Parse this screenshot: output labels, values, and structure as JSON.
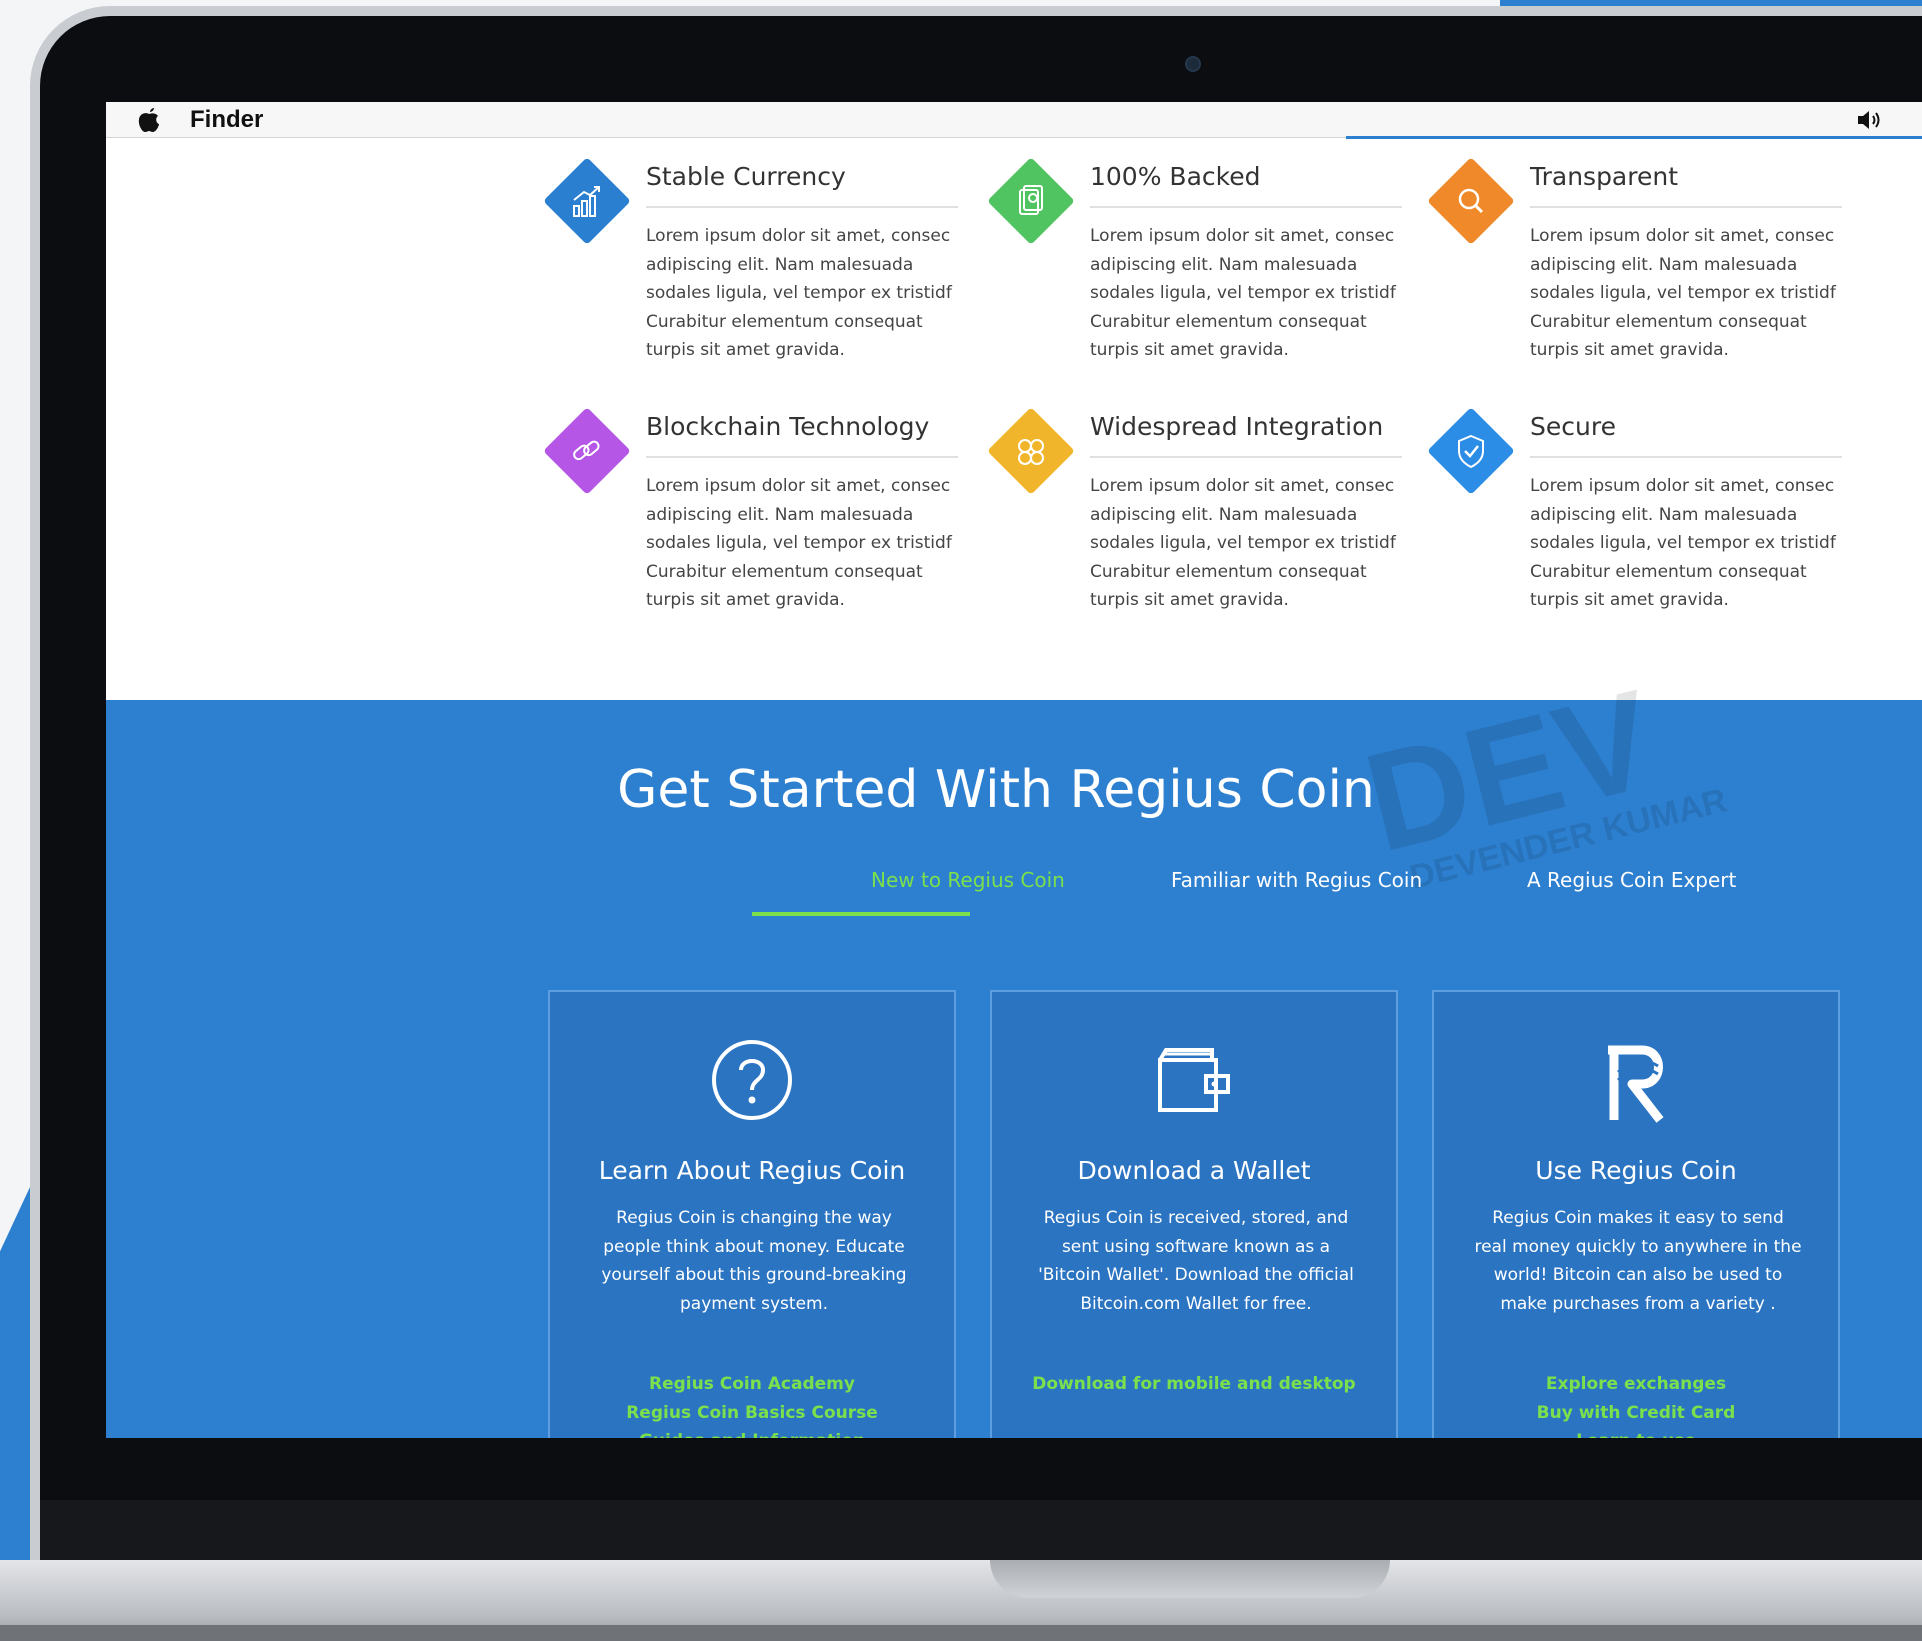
{
  "menubar": {
    "app_name": "Finder",
    "apple_icon": "apple-logo-icon",
    "volume_icon": "speaker-volume-icon"
  },
  "features": [
    {
      "title": "Stable Currency",
      "icon": "growth-chart-icon",
      "color": "#2a7fd0",
      "text": "Lorem ipsum dolor sit amet, consec adipiscing elit. Nam malesuada sodales ligula, vel tempor ex tristidf Curabitur elementum consequat turpis sit amet gravida."
    },
    {
      "title": "100% Backed",
      "icon": "money-stack-icon",
      "color": "#4fc460",
      "text": "Lorem ipsum dolor sit amet, consec adipiscing elit. Nam malesuada sodales ligula, vel tempor ex tristidf Curabitur elementum consequat turpis sit amet gravida."
    },
    {
      "title": "Transparent",
      "icon": "magnifier-icon",
      "color": "#f0892a",
      "text": "Lorem ipsum dolor sit amet, consec adipiscing elit. Nam malesuada sodales ligula, vel tempor ex tristidf Curabitur elementum consequat turpis sit amet gravida."
    },
    {
      "title": "Blockchain Technology",
      "icon": "chain-link-icon",
      "color": "#b556e6",
      "text": "Lorem ipsum dolor sit amet, consec adipiscing elit. Nam malesuada sodales ligula, vel tempor ex tristidf Curabitur elementum consequat turpis sit amet gravida."
    },
    {
      "title": "Widespread Integration",
      "icon": "integration-puzzle-icon",
      "color": "#f1b52b",
      "text": "Lorem ipsum dolor sit amet, consec adipiscing elit. Nam malesuada sodales ligula, vel tempor ex tristidf Curabitur elementum consequat turpis sit amet gravida."
    },
    {
      "title": "Secure",
      "icon": "shield-check-icon",
      "color": "#2b8de6",
      "text": "Lorem ipsum dolor sit amet, consec adipiscing elit. Nam malesuada sodales ligula, vel tempor ex tristidf Curabitur elementum consequat turpis sit amet gravida."
    }
  ],
  "get_started": {
    "title": "Get Started With Regius Coin",
    "tabs": [
      {
        "label": "New to Regius Coin",
        "active": true
      },
      {
        "label": "Familiar with Regius Coin",
        "active": false
      },
      {
        "label": "A Regius Coin Expert",
        "active": false
      }
    ],
    "cards": [
      {
        "icon": "question-circle-icon",
        "title": "Learn About Regius Coin",
        "text": "Regius Coin is changing the way people think about money. Educate yourself about this ground-breaking payment system.",
        "links": [
          "Regius Coin Academy",
          "Regius Coin Basics Course",
          "Guides and Information"
        ]
      },
      {
        "icon": "wallet-icon",
        "title": "Download a Wallet",
        "text": "Regius Coin is received, stored, and sent using software known as a 'Bitcoin Wallet'. Download the official Bitcoin.com Wallet for free.",
        "links": [
          "Download for mobile and desktop"
        ]
      },
      {
        "icon": "regius-r-logo-icon",
        "title": "Use Regius Coin",
        "text": "Regius Coin makes it easy to send real money quickly to anywhere in the world! Bitcoin can also be used to make purchases from a variety .",
        "links": [
          "Explore exchanges",
          "Buy with Credit Card",
          "Learn to use"
        ]
      }
    ]
  },
  "watermark": {
    "main": "DEV",
    "sub": "DEVENDER KUMAR"
  },
  "colors": {
    "primary_blue": "#2d7fd0",
    "link_green": "#7be04c",
    "card_blue": "#2a74c2"
  }
}
